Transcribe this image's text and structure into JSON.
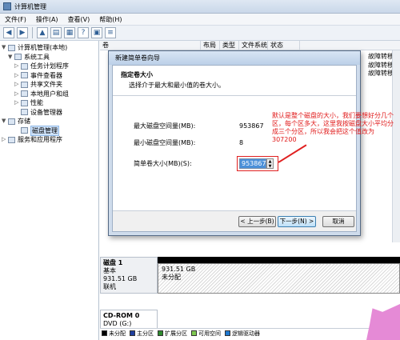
{
  "window": {
    "title": "计算机管理"
  },
  "menu": [
    "文件(F)",
    "操作(A)",
    "查看(V)",
    "帮助(H)"
  ],
  "tree": [
    {
      "label": "计算机管理(本地)",
      "level": 0,
      "expander": "▼"
    },
    {
      "label": "系统工具",
      "level": 1,
      "expander": "▼"
    },
    {
      "label": "任务计划程序",
      "level": 2,
      "expander": "▷"
    },
    {
      "label": "事件查看器",
      "level": 2,
      "expander": "▷"
    },
    {
      "label": "共享文件夹",
      "level": 2,
      "expander": "▷"
    },
    {
      "label": "本地用户和组",
      "level": 2,
      "expander": "▷"
    },
    {
      "label": "性能",
      "level": 2,
      "expander": "▷"
    },
    {
      "label": "设备管理器",
      "level": 2,
      "expander": ""
    },
    {
      "label": "存储",
      "level": 1,
      "expander": "▼"
    },
    {
      "label": "磁盘管理",
      "level": 2,
      "expander": "",
      "selected": true
    },
    {
      "label": "服务和应用程序",
      "level": 1,
      "expander": "▷"
    }
  ],
  "columns": [
    "卷",
    "布局",
    "类型",
    "文件系统",
    "状态"
  ],
  "action_links": [
    "故障转移",
    "故障转移",
    "故障转移"
  ],
  "dialog": {
    "title": "新建简单卷向导",
    "heading": "指定卷大小",
    "subheading": "选择介于最大和最小值的卷大小。",
    "fields": [
      {
        "label": "最大磁盘空间量(MB):",
        "value": "953867"
      },
      {
        "label": "最小磁盘空间量(MB):",
        "value": "8"
      }
    ],
    "size_label": "简单卷大小(MB)(S):",
    "size_value": "953867",
    "back_button": "< 上一步(B)",
    "next_button": "下一步(N) >",
    "cancel_button": "取消"
  },
  "annotation": "默认是整个磁盘的大小，我们要想好分几个区，每个区多大，这里我按磁盘大小平均分成三个分区，所以我会把这个值改为307200",
  "disk1": {
    "title": "磁盘 1",
    "type": "基本",
    "size": "931.51 GB",
    "status": "联机",
    "part_size": "931.51 GB",
    "part_status": "未分配"
  },
  "cdrom": {
    "title": "CD-ROM 0",
    "label": "DVD (G:)"
  },
  "legend": [
    {
      "label": "未分配",
      "color": "#000000"
    },
    {
      "label": "主分区",
      "color": "#1f3f9f"
    },
    {
      "label": "扩展分区",
      "color": "#2e8b2e"
    },
    {
      "label": "可用空间",
      "color": "#7ec850"
    },
    {
      "label": "逻辑驱动器",
      "color": "#1e78d0"
    }
  ],
  "colors": {
    "accent": "#4a90d9",
    "annotation": "#e01818",
    "dialog_bg": "#cfdcec"
  }
}
